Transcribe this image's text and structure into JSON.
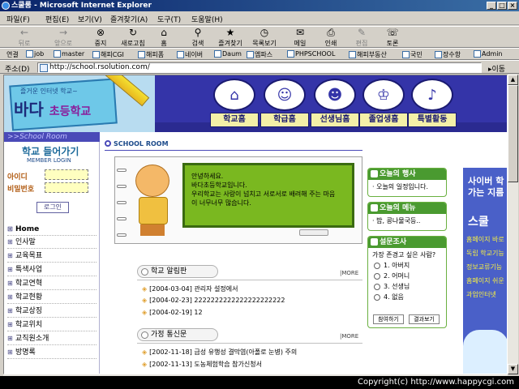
{
  "window": {
    "title": "스쿨룸 - Microsoft Internet Explorer"
  },
  "menubar": [
    "파일(F)",
    "편집(E)",
    "보기(V)",
    "즐겨찾기(A)",
    "도구(T)",
    "도움말(H)"
  ],
  "toolbar": [
    {
      "label": "뒤로",
      "icon": "back-arrow-icon",
      "enabled": false
    },
    {
      "label": "앞으로",
      "icon": "forward-arrow-icon",
      "enabled": false
    },
    {
      "label": "중지",
      "icon": "stop-icon",
      "enabled": true
    },
    {
      "label": "새로고침",
      "icon": "refresh-icon",
      "enabled": true
    },
    {
      "label": "홈",
      "icon": "home-icon",
      "enabled": true
    },
    {
      "label": "검색",
      "icon": "search-icon",
      "enabled": true
    },
    {
      "label": "즐겨찾기",
      "icon": "favorites-icon",
      "enabled": true
    },
    {
      "label": "목록보기",
      "icon": "history-icon",
      "enabled": true
    },
    {
      "label": "메일",
      "icon": "mail-icon",
      "enabled": true
    },
    {
      "label": "인쇄",
      "icon": "print-icon",
      "enabled": true
    },
    {
      "label": "편집",
      "icon": "edit-icon",
      "enabled": false
    },
    {
      "label": "토론",
      "icon": "discuss-icon",
      "enabled": true
    }
  ],
  "links": {
    "label": "연결",
    "items": [
      "job",
      "master",
      "해피CGI",
      "해피폼",
      "네이버",
      "Daum",
      "엠파스",
      "PHPSCHOOL",
      "해피부동산",
      "국민",
      "장수항",
      "Admin"
    ]
  },
  "address": {
    "label": "주소(D)",
    "url": "http://school.rsolution.com/",
    "go": "이동"
  },
  "site": {
    "logo_sub": "즐거운 인터넷 학교~",
    "logo_main": "바다",
    "logo_main2": "초등학교",
    "nav": [
      {
        "label": "학교홈",
        "icon": "school-icon"
      },
      {
        "label": "학급홈",
        "icon": "class-icon"
      },
      {
        "label": "선생님홈",
        "icon": "teacher-icon"
      },
      {
        "label": "졸업생홈",
        "icon": "graduate-icon"
      },
      {
        "label": "특별활동",
        "icon": "activity-icon"
      }
    ],
    "left": {
      "band": ">>School Room",
      "login_title": "학교 들어가기",
      "login_sub": "MEMBER LOGIN",
      "id_label": "아이디",
      "pw_label": "비밀번호",
      "login_button": "로그인",
      "menu": [
        "Home",
        "인사말",
        "교육목표",
        "특색사업",
        "학교연혁",
        "학교현황",
        "학교상징",
        "학교위치",
        "교직원소개",
        "방명록"
      ]
    },
    "main": {
      "section_label": "SCHOOL ROOM",
      "welcome": [
        "안녕하세요.",
        "바다초등학교입니다.",
        "우리학교는 사랑이 넘치고 서로서로 배려해 주는 마음",
        "이 너무너무 많습니다."
      ],
      "notice": {
        "title": "학교 알림판",
        "more": "|MORE",
        "items": [
          "[2004-03-04] 관리자 설정에서",
          "[2004-02-23] 2222222222222222222222",
          "[2004-02-19] 12"
        ]
      },
      "home": {
        "title": "가정 통신문",
        "more": "|MORE",
        "items": [
          "[2002-11-18] 급성 유행성 결막염(아폴로 눈병) 주의",
          "[2002-11-13] 도농체험학습 참가신청서"
        ]
      }
    },
    "right": {
      "event": {
        "title": "오늘의 행사",
        "body": "· 오늘의 일정입니다."
      },
      "menu": {
        "title": "오늘의 메뉴",
        "body": "· 밥, 콩나물국등.."
      },
      "poll": {
        "title": "설문조사",
        "question": "가장 존경고 싶은 사람?",
        "options": [
          "1. 아버지",
          "2. 어머니",
          "3. 선생님",
          "4. 없음"
        ],
        "vote_button": "참여하기",
        "result_button": "결과보기"
      }
    },
    "banner": {
      "line1": "사이버 학",
      "line2": "가는 지름",
      "line3": "스쿨",
      "items": [
        "홈페이지 바로",
        "독립 학교기능",
        "정보교류기능",
        "홈페이지 쉬운",
        "과업인터넷"
      ]
    }
  },
  "status": {
    "text": "Copyright(c) http://www.happycgi.com"
  }
}
